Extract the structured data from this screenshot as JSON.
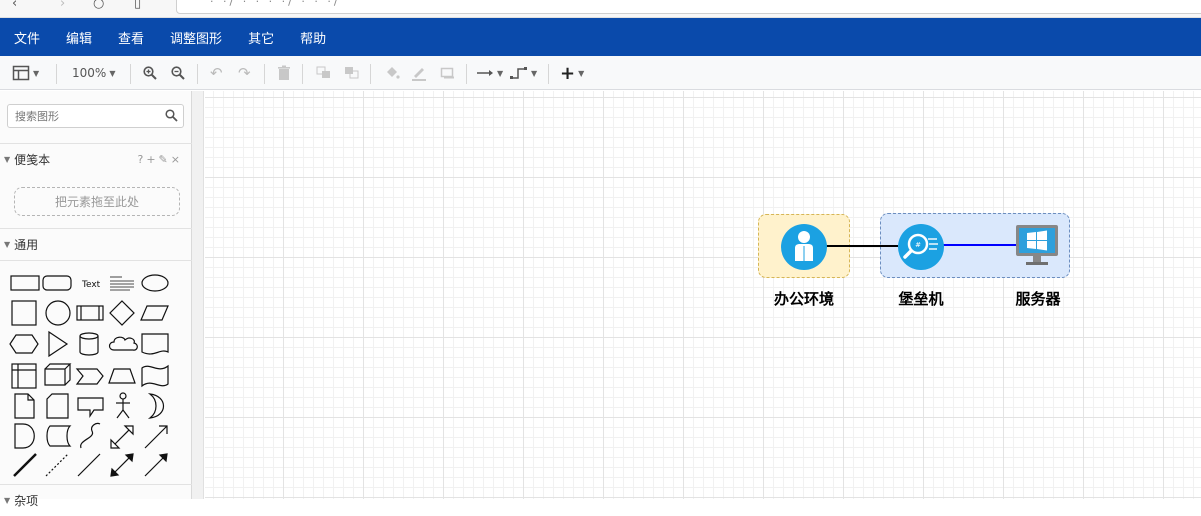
{
  "menubar": {
    "items": [
      "文件",
      "编辑",
      "查看",
      "调整图形",
      "其它",
      "帮助"
    ]
  },
  "toolbar": {
    "zoom": "100%"
  },
  "sidebar": {
    "search_placeholder": "搜索图形",
    "scratchpad_title": "便笺本",
    "scratchpad_tools": "?+✎×",
    "drop_hint": "把元素拖至此处",
    "general_title": "通用",
    "text_shape_label": "Text",
    "next_section": "杂项"
  },
  "diagram": {
    "nodes": [
      {
        "label": "办公环境",
        "icon": "user-icon"
      },
      {
        "label": "堡垒机",
        "icon": "bastion-search-icon"
      },
      {
        "label": "服务器",
        "icon": "windows-monitor-icon"
      }
    ],
    "colors": {
      "office_fill": "#fff2cc",
      "server_fill": "#dae8fc",
      "icon_blue": "#1ba1e2",
      "edge_blue": "#0000ff"
    }
  }
}
